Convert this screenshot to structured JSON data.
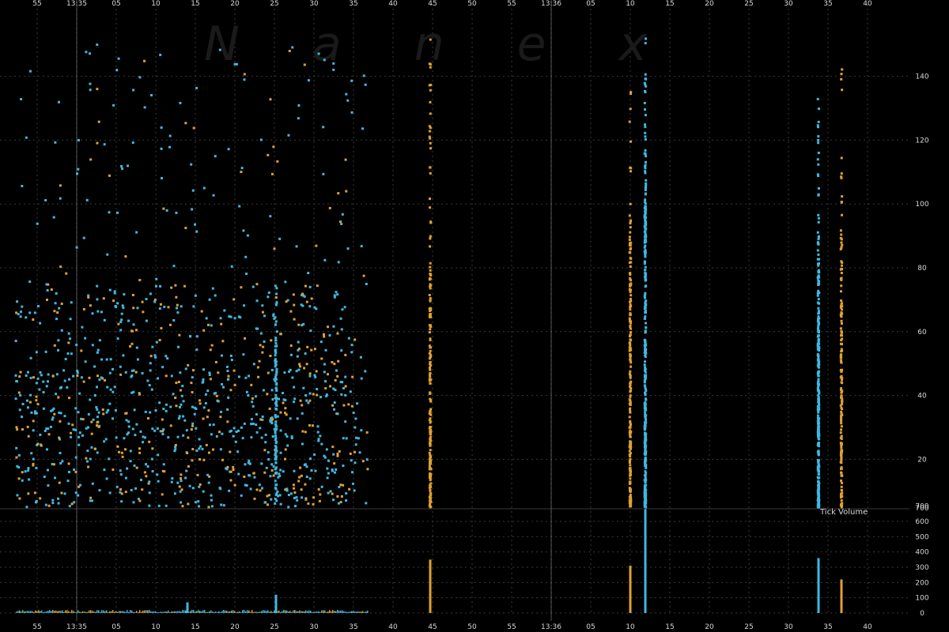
{
  "watermark": "N a n e x",
  "colors": {
    "background": "#000000",
    "grid": "#3a3a3a",
    "tick_text": "#d8d8d8",
    "series_blue": "#3fb8e0",
    "series_orange": "#e0a030",
    "minute_line": "#8a8a8a"
  },
  "chart_data": [
    {
      "type": "scatter",
      "title": "",
      "x_tick_labels": [
        "55",
        "13:35",
        "05",
        "10",
        "15",
        "20",
        "25",
        "30",
        "35",
        "40",
        "45",
        "50",
        "55",
        "13:36",
        "05",
        "10",
        "15",
        "20",
        "25",
        "30",
        "35",
        "40"
      ],
      "y_tick_labels": [
        "20",
        "40",
        "60",
        "80",
        "100",
        "120",
        "140"
      ],
      "y_bottom_label": "700",
      "grid": true,
      "series": [
        {
          "color": "blue"
        },
        {
          "color": "orange"
        }
      ]
    },
    {
      "type": "bar",
      "title": "Tick Volume",
      "y_tick_labels": [
        "0",
        "100",
        "200",
        "300",
        "400",
        "500",
        "600",
        "700"
      ],
      "ylim": [
        0,
        700
      ],
      "grid": true,
      "spikes": [
        {
          "x_label": "45",
          "value": 350,
          "color": "orange"
        },
        {
          "x_label": "10",
          "value": 310,
          "color": "orange"
        },
        {
          "x_label": "12",
          "value": 680,
          "color": "blue"
        },
        {
          "x_label": "34",
          "value": 360,
          "color": "blue"
        },
        {
          "x_label": "37",
          "value": 220,
          "color": "orange"
        },
        {
          "x_label": "25",
          "value": 120,
          "color": "blue"
        },
        {
          "x_label": "14",
          "value": 70,
          "color": "blue"
        }
      ]
    }
  ]
}
